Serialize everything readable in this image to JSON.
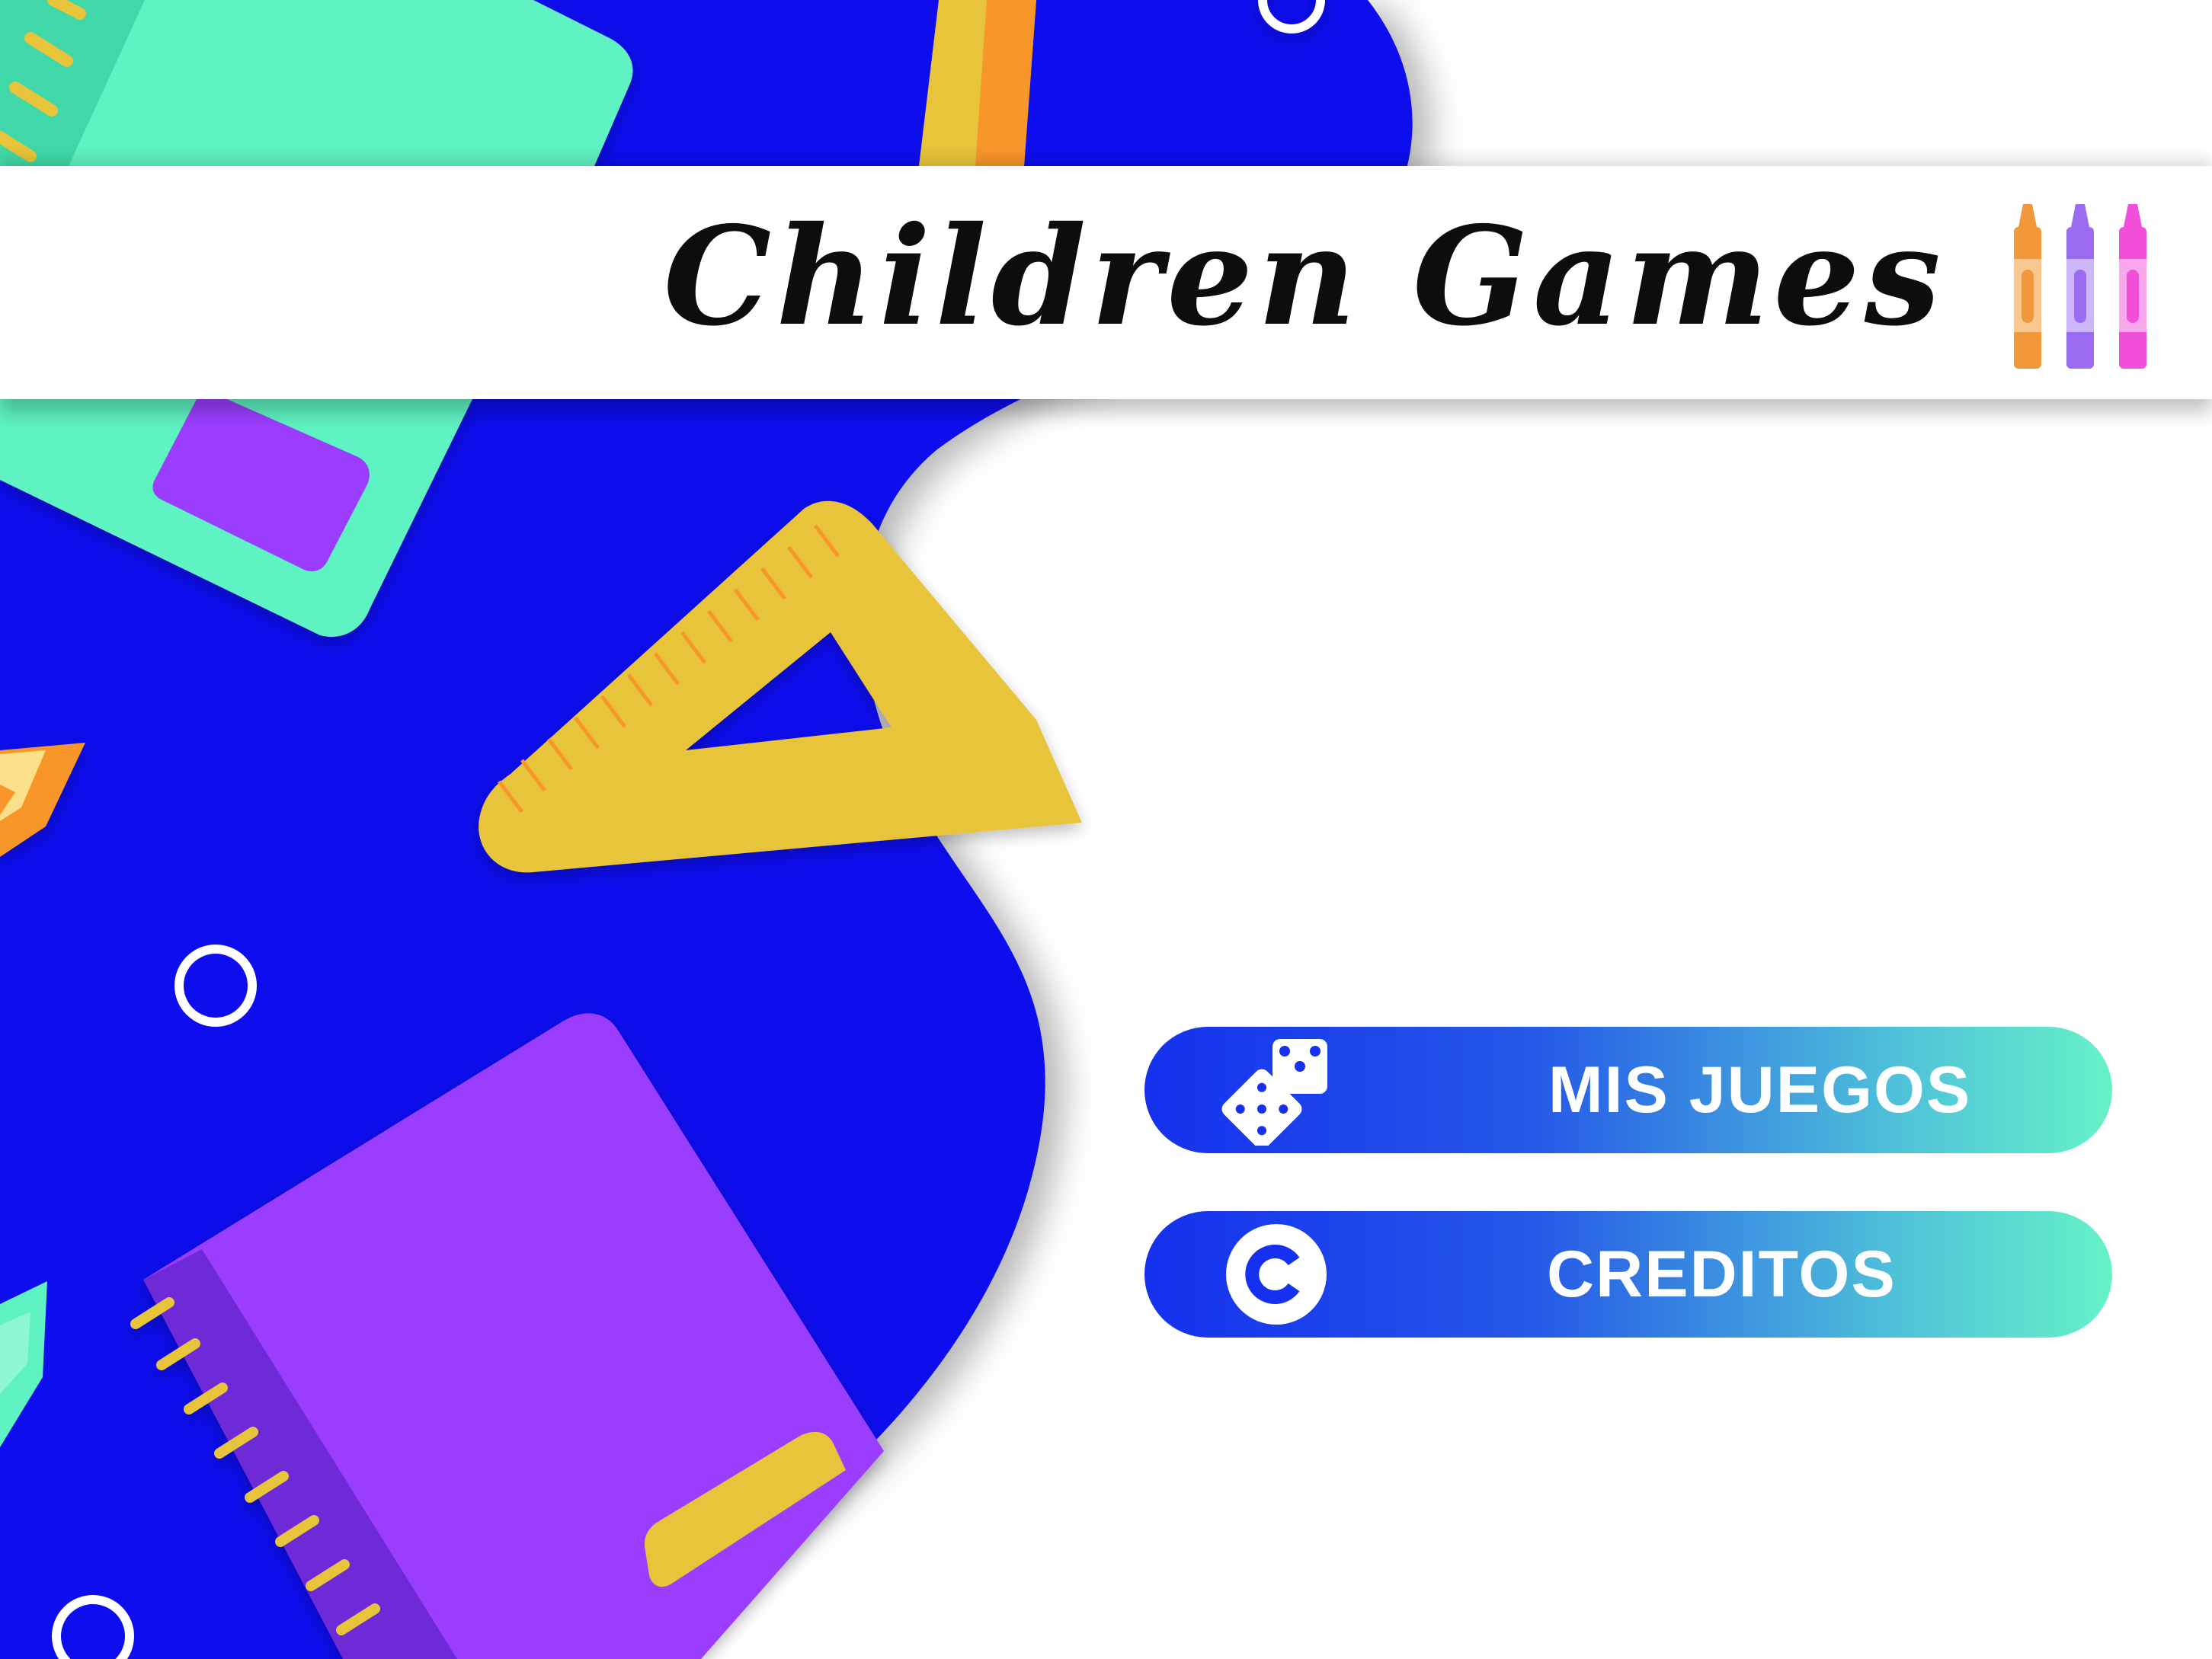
{
  "app": {
    "title": "Children Games",
    "crayon_colors": [
      "#f0983a",
      "#9b6cf2",
      "#f24fd8"
    ]
  },
  "menu": {
    "items": [
      {
        "id": "mis-juegos",
        "label": "MIS JUEGOS",
        "icon": "dice-icon"
      },
      {
        "id": "creditos",
        "label": "CREDITOS",
        "icon": "copyright-icon"
      }
    ]
  },
  "theme": {
    "background_blue": "#1010ee",
    "notebook_green": "#5ff2c2",
    "notebook_purple": "#9b3dff",
    "ruler_yellow": "#e8c43a",
    "pencil_orange": "#f8962a",
    "button_gradient_start": "#1530ee",
    "button_gradient_end": "#66f2c8"
  }
}
